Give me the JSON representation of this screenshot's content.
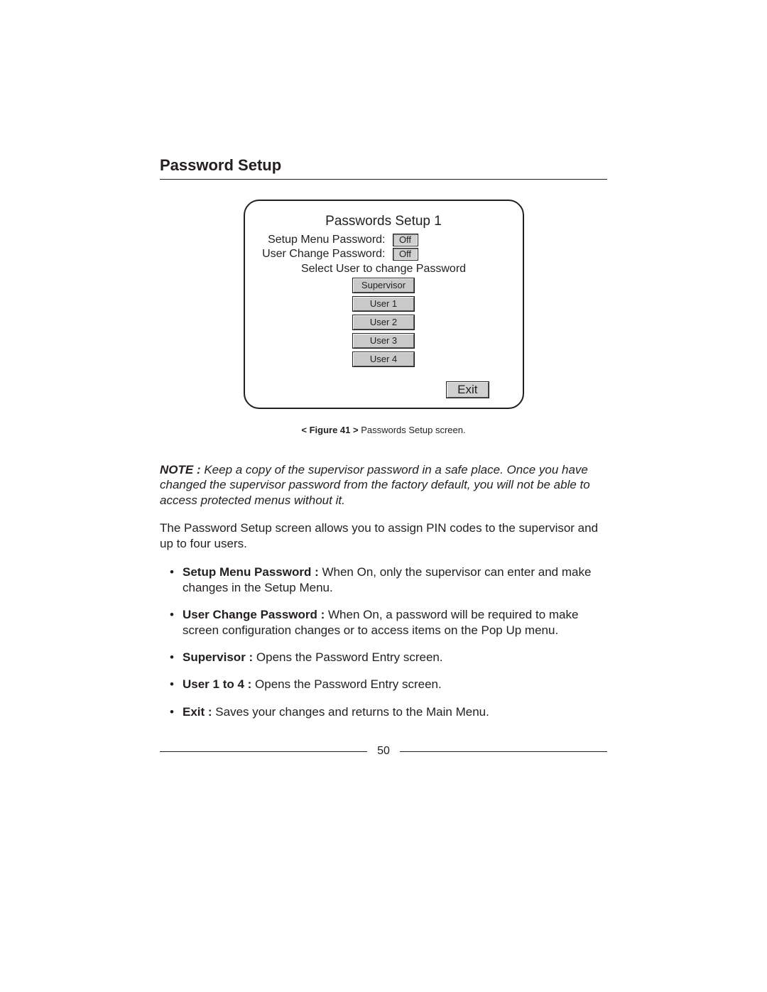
{
  "heading": "Password Setup",
  "figure": {
    "title": "Passwords Setup 1",
    "rows": [
      {
        "label": "Setup Menu Password:",
        "value": "Off"
      },
      {
        "label": "User Change Password:",
        "value": "Off"
      }
    ],
    "select_label": "Select User to change Password",
    "users": [
      "Supervisor",
      "User 1",
      "User 2",
      "User 3",
      "User 4"
    ],
    "exit": "Exit",
    "caption_prefix": "< Figure 41 >",
    "caption_text": " Passwords Setup screen."
  },
  "note": {
    "label": "NOTE :",
    "text": "  Keep a copy of the supervisor password in a safe place.  Once you have changed the supervisor password from the factory default, you will not be able to access protected menus without it."
  },
  "body_paragraph": "The Password Setup screen allows you to assign PIN codes to the supervisor and up to four users.",
  "bullets": [
    {
      "label": "Setup Menu Password :",
      "text": "  When On, only the supervisor can enter and make changes in the Setup Menu."
    },
    {
      "label": "User Change Password :",
      "text": "  When On, a password will be required to make screen configuration changes or to access items on the Pop Up menu."
    },
    {
      "label": "Supervisor :",
      "text": "  Opens the Password Entry screen."
    },
    {
      "label": "User 1 to 4 :",
      "text": "  Opens the Password Entry screen."
    },
    {
      "label": "Exit :",
      "text": "  Saves your changes and returns to the Main Menu."
    }
  ],
  "page_number": "50"
}
